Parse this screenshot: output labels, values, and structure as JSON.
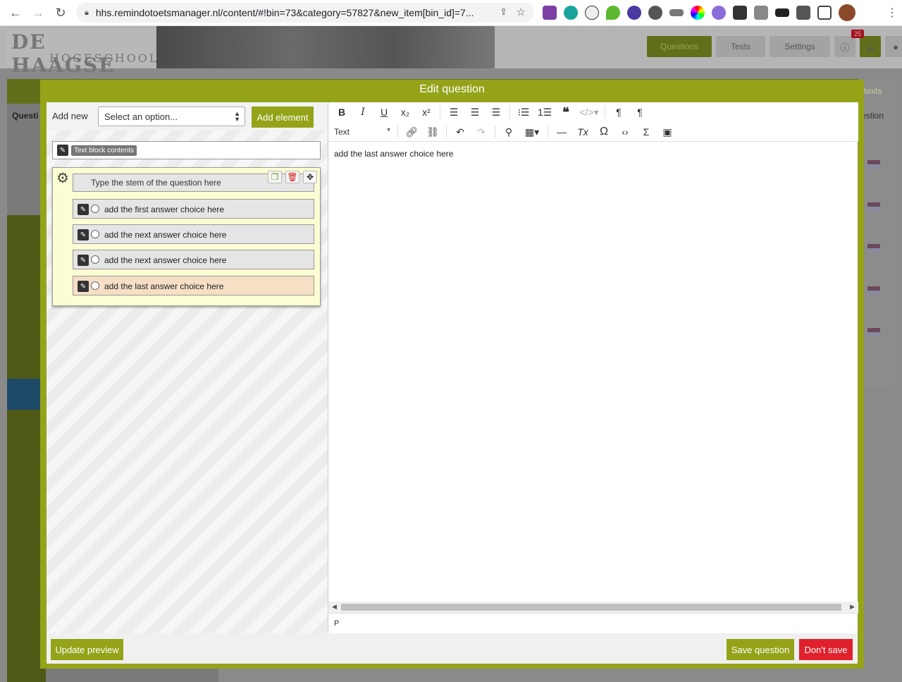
{
  "browser": {
    "url": "hhs.remindotoetsmanager.nl/content/#!bin=73&category=57827&new_item[bin_id]=7..."
  },
  "site": {
    "logo_top": "DE HAAGSE",
    "logo_bottom": "HOGESCHOOL",
    "nav": {
      "questions": "Questions",
      "tests": "Tests",
      "settings": "Settings"
    },
    "notification_count": "25",
    "bg_texts": "texts",
    "bg_question": "estion",
    "bg_questi": "Questi"
  },
  "modal": {
    "title": "Edit question",
    "add_new_label": "Add new",
    "select_placeholder": "Select an option...",
    "add_element": "Add element",
    "text_block_badge": "Text block contents",
    "stem": "Type the stem of the question here",
    "choices": [
      "add the first answer choice here",
      "add the next answer choice here",
      "add the next answer choice here",
      "add the last answer choice here"
    ],
    "format_select": "Text",
    "editor_content": "add the last answer choice here",
    "status_path": "P",
    "update_preview": "Update preview",
    "save_question": "Save question",
    "dont_save": "Don't save"
  },
  "colors": {
    "accent": "#95a319",
    "danger": "#e0202d",
    "active_choice": "#f6dfc5"
  }
}
